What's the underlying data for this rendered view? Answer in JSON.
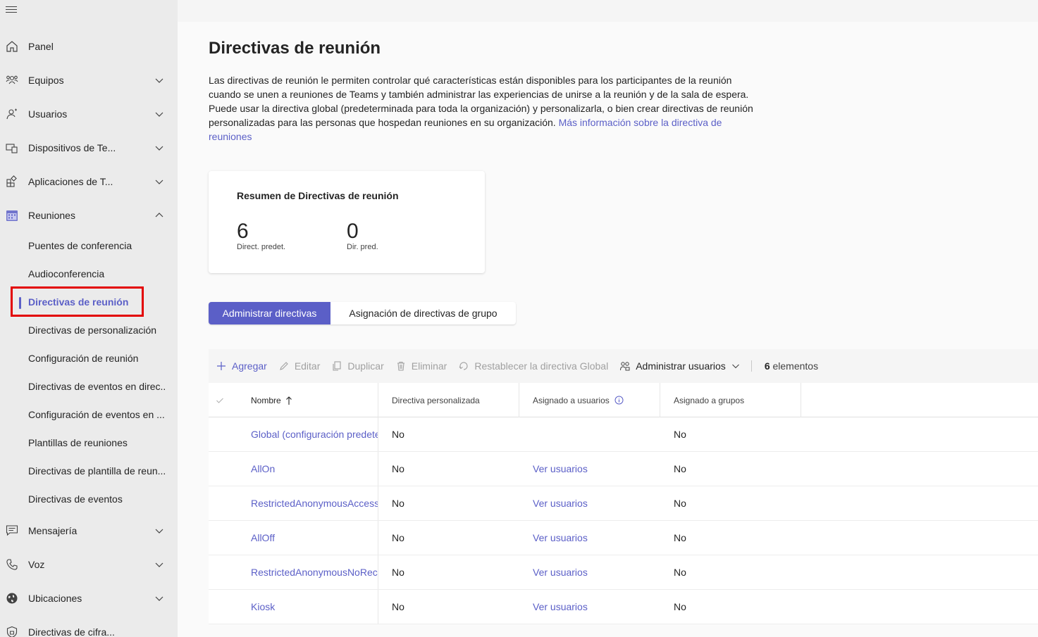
{
  "sidebar": {
    "items": [
      {
        "label": "Panel",
        "icon": "home-icon",
        "chevron": false
      },
      {
        "label": "Equipos",
        "icon": "teams-icon",
        "chevron": "down"
      },
      {
        "label": "Usuarios",
        "icon": "users-icon",
        "chevron": "down"
      },
      {
        "label": "Dispositivos de Te...",
        "icon": "devices-icon",
        "chevron": "down"
      },
      {
        "label": "Aplicaciones de T...",
        "icon": "apps-icon",
        "chevron": "down"
      },
      {
        "label": "Reuniones",
        "icon": "calendar-icon",
        "chevron": "up"
      }
    ],
    "subitems": [
      "Puentes de conferencia",
      "Audioconferencia",
      "Directivas de reunión",
      "Directivas de personalización",
      "Configuración de reunión",
      "Directivas de eventos en direc...",
      "Configuración de eventos en ...",
      "Plantillas de reuniones",
      "Directivas de plantilla de reun...",
      "Directivas de eventos"
    ],
    "bottom_items": [
      {
        "label": "Mensajería",
        "icon": "chat-icon"
      },
      {
        "label": "Voz",
        "icon": "phone-icon"
      },
      {
        "label": "Ubicaciones",
        "icon": "globe-icon"
      },
      {
        "label": "Directivas de cifra...",
        "icon": "shield-icon"
      }
    ]
  },
  "page": {
    "title": "Directivas de reunión",
    "description": "Las directivas de reunión le permiten controlar qué características están disponibles para los participantes de la reunión cuando se unen a reuniones de Teams y también administrar las experiencias de unirse a la reunión y de la sala de espera. Puede usar la directiva global (predeterminada para toda la organización) y personalizarla, o bien crear directivas de reunión personalizadas para las personas que hospedan reuniones en su organización. ",
    "learn_more": "Más información sobre la directiva de reuniones"
  },
  "summary": {
    "title": "Resumen de Directivas de reunión",
    "stat1_value": "6",
    "stat1_label": "Direct. predet.",
    "stat2_value": "0",
    "stat2_label": "Dir. pred."
  },
  "tabs": {
    "manage": "Administrar directivas",
    "group": "Asignación de directivas de grupo"
  },
  "toolbar": {
    "add": "Agregar",
    "edit": "Editar",
    "duplicate": "Duplicar",
    "delete": "Eliminar",
    "reset": "Restablecer la directiva Global",
    "manage_users": "Administrar usuarios",
    "count_num": "6",
    "count_label": " elementos"
  },
  "table": {
    "headers": {
      "name": "Nombre",
      "custom": "Directiva personalizada",
      "assigned_users": "Asignado a usuarios",
      "assigned_groups": "Asignado a grupos"
    },
    "rows": [
      {
        "name": "Global (configuración predeterminada de toda la organización)",
        "custom": "No",
        "users": "",
        "groups": "No"
      },
      {
        "name": "AllOn",
        "custom": "No",
        "users": "Ver usuarios",
        "groups": "No"
      },
      {
        "name": "RestrictedAnonymousAccess",
        "custom": "No",
        "users": "Ver usuarios",
        "groups": "No"
      },
      {
        "name": "AllOff",
        "custom": "No",
        "users": "Ver usuarios",
        "groups": "No"
      },
      {
        "name": "RestrictedAnonymousNoRecording",
        "custom": "No",
        "users": "Ver usuarios",
        "groups": "No"
      },
      {
        "name": "Kiosk",
        "custom": "No",
        "users": "Ver usuarios",
        "groups": "No"
      }
    ]
  },
  "colors": {
    "accent": "#5b5fc7",
    "highlight": "#e30000"
  }
}
